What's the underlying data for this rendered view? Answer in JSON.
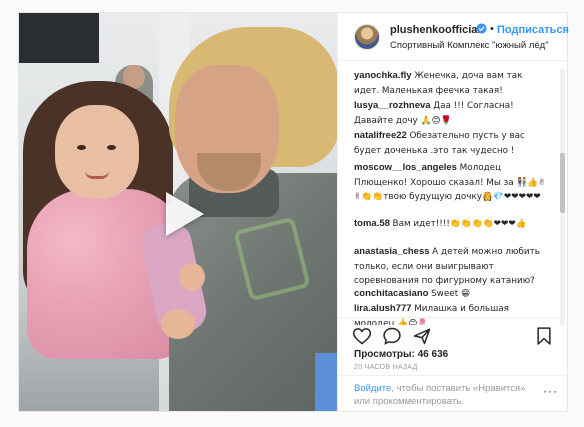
{
  "post": {
    "author": {
      "username": "plushenkoofficial",
      "verified": true,
      "follow_label": "Подписаться",
      "location": "Спортивный Комплекс \"южный лёд\""
    },
    "video": {
      "play_icon": "play-icon"
    },
    "comments": [
      {
        "user": "yanochka.fly",
        "text": "Женечка, доча вам так идет. Маленькая феечка такая!"
      },
      {
        "user": "lusya__rozhneva",
        "text": "Даа !!! Согласна! Давайте дочу 🙏😊🌹"
      },
      {
        "user": "natalifree22",
        "text": "Обезательно пусть у вас будет доченька .это так чудесно !"
      },
      {
        "user": "moscow__los_angeles",
        "text": "Молодец Плющенко! Хорошо сказал! Мы за 👫👍✌✌👏👏твою будущую дочку👸💎❤❤❤❤❤"
      },
      {
        "user": "toma.58",
        "text": "Вам идет!!!!👏👏👏👏❤❤❤👍"
      },
      {
        "user": "anastasia_chess",
        "text": "А детей можно любить только, если они выигрывают соревнования по фигурному катанию?"
      },
      {
        "user": "conchitacasiano",
        "text": "Sweet 😁"
      },
      {
        "user": "lira.alush777",
        "text": "Милашка и большая молодец 👍😊🌷"
      }
    ],
    "actions": {
      "like_icon": "heart-icon",
      "comment_icon": "comment-icon",
      "share_icon": "share-icon",
      "save_icon": "bookmark-icon"
    },
    "views_label": "Просмотры: 46 636",
    "time_ago": "20 ЧАСОВ НАЗАД",
    "login": {
      "link": "Войдите",
      "text": ", чтобы поставить «Нравится» или прокомментировать.",
      "more_label": "···"
    }
  },
  "colors": {
    "link_blue": "#3897f0",
    "text_dark": "#262626",
    "muted": "#999999",
    "border": "#efefef"
  }
}
